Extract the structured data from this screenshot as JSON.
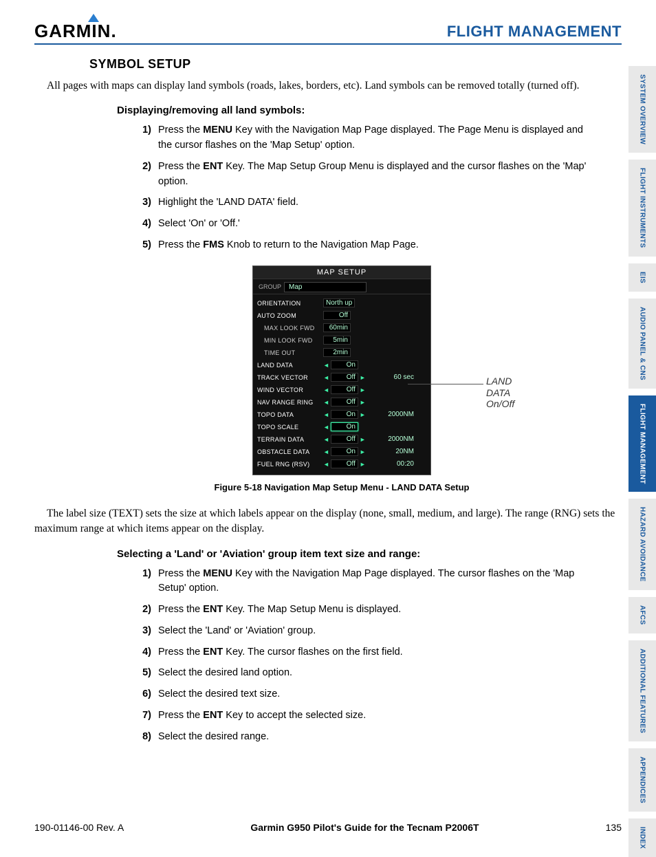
{
  "header": {
    "brand": "GARMIN",
    "section": "FLIGHT MANAGEMENT"
  },
  "side_tabs": [
    {
      "label": "SYSTEM OVERVIEW",
      "active": false
    },
    {
      "label": "FLIGHT INSTRUMENTS",
      "active": false
    },
    {
      "label": "EIS",
      "active": false
    },
    {
      "label": "AUDIO PANEL & CNS",
      "active": false
    },
    {
      "label": "FLIGHT MANAGEMENT",
      "active": true
    },
    {
      "label": "HAZARD AVOIDANCE",
      "active": false
    },
    {
      "label": "AFCS",
      "active": false
    },
    {
      "label": "ADDITIONAL FEATURES",
      "active": false
    },
    {
      "label": "APPENDICES",
      "active": false
    },
    {
      "label": "INDEX",
      "active": false
    }
  ],
  "section_heading": "SYMBOL SETUP",
  "intro_para": "All pages with maps can display land symbols (roads, lakes, borders, etc).  Land symbols can be removed totally (turned off).",
  "proc1": {
    "title": "Displaying/removing all land symbols:",
    "steps": [
      {
        "pre": "Press the ",
        "bold": "MENU",
        "post": " Key with the Navigation Map Page displayed.  The Page Menu is displayed and the cursor flashes on the 'Map Setup' option."
      },
      {
        "pre": "Press the ",
        "bold": "ENT",
        "post": " Key.  The Map Setup Group Menu is displayed and the cursor flashes on the 'Map' option."
      },
      {
        "pre": "",
        "bold": "",
        "post": "Highlight the 'LAND DATA' field."
      },
      {
        "pre": "",
        "bold": "",
        "post": "Select 'On' or 'Off.'"
      },
      {
        "pre": "Press the ",
        "bold": "FMS",
        "post": " Knob to return to the Navigation Map Page."
      }
    ]
  },
  "figure": {
    "title": "MAP SETUP",
    "group_label": "GROUP",
    "group_value": "Map",
    "rows": [
      {
        "label": "ORIENTATION",
        "sub": false,
        "lar": false,
        "val": "North up",
        "rar": false,
        "extra": "",
        "hl": false
      },
      {
        "label": "AUTO ZOOM",
        "sub": false,
        "lar": false,
        "val": "Off",
        "rar": false,
        "extra": "",
        "hl": false
      },
      {
        "label": "MAX LOOK FWD",
        "sub": true,
        "lar": false,
        "val": "60min",
        "rar": false,
        "extra": "",
        "hl": false
      },
      {
        "label": "MIN LOOK FWD",
        "sub": true,
        "lar": false,
        "val": "5min",
        "rar": false,
        "extra": "",
        "hl": false
      },
      {
        "label": "TIME OUT",
        "sub": true,
        "lar": false,
        "val": "2min",
        "rar": false,
        "extra": "",
        "hl": false
      },
      {
        "label": "LAND DATA",
        "sub": false,
        "lar": true,
        "val": "On",
        "rar": false,
        "extra": "",
        "hl": false
      },
      {
        "label": "TRACK VECTOR",
        "sub": false,
        "lar": true,
        "val": "Off",
        "rar": true,
        "extra": "60 sec",
        "hl": false
      },
      {
        "label": "WIND VECTOR",
        "sub": false,
        "lar": true,
        "val": "Off",
        "rar": true,
        "extra": "",
        "hl": false
      },
      {
        "label": "NAV RANGE RING",
        "sub": false,
        "lar": true,
        "val": "Off",
        "rar": true,
        "extra": "",
        "hl": false
      },
      {
        "label": "TOPO DATA",
        "sub": false,
        "lar": true,
        "val": "On",
        "rar": true,
        "extra": "2000NM",
        "hl": false
      },
      {
        "label": "TOPO SCALE",
        "sub": false,
        "lar": true,
        "val": "On",
        "rar": false,
        "extra": "",
        "hl": true
      },
      {
        "label": "TERRAIN DATA",
        "sub": false,
        "lar": true,
        "val": "Off",
        "rar": true,
        "extra": "2000NM",
        "hl": false
      },
      {
        "label": "OBSTACLE DATA",
        "sub": false,
        "lar": true,
        "val": "On",
        "rar": true,
        "extra": "20NM",
        "hl": false
      },
      {
        "label": "FUEL RNG (RSV)",
        "sub": false,
        "lar": true,
        "val": "Off",
        "rar": true,
        "extra": "00:20",
        "hl": false
      }
    ],
    "callout": "LAND DATA On/Off",
    "caption": "Figure 5-18  Navigation Map Setup Menu - LAND DATA Setup"
  },
  "mid_para": "The label size (TEXT) sets the size at which labels appear on the display (none, small, medium, and large).  The range (RNG) sets the maximum range at which items appear on the display.",
  "proc2": {
    "title": "Selecting a 'Land' or 'Aviation' group item text size and range:",
    "steps": [
      {
        "pre": "Press the ",
        "bold": "MENU",
        "post": " Key with the Navigation Map Page displayed.  The cursor flashes on the 'Map Setup' option."
      },
      {
        "pre": "Press the ",
        "bold": "ENT",
        "post": " Key.  The Map Setup Menu is displayed."
      },
      {
        "pre": "",
        "bold": "",
        "post": "Select the 'Land'  or 'Aviation' group."
      },
      {
        "pre": "Press the ",
        "bold": "ENT",
        "post": " Key.  The cursor flashes on the first field."
      },
      {
        "pre": "",
        "bold": "",
        "post": "Select the desired land option."
      },
      {
        "pre": "",
        "bold": "",
        "post": "Select the desired text size."
      },
      {
        "pre": "Press the ",
        "bold": "ENT",
        "post": " Key to accept the selected size."
      },
      {
        "pre": "",
        "bold": "",
        "post": "Select the desired range."
      }
    ]
  },
  "footer": {
    "left": "190-01146-00  Rev. A",
    "center": "Garmin G950 Pilot's Guide for the Tecnam P2006T",
    "right": "135"
  }
}
